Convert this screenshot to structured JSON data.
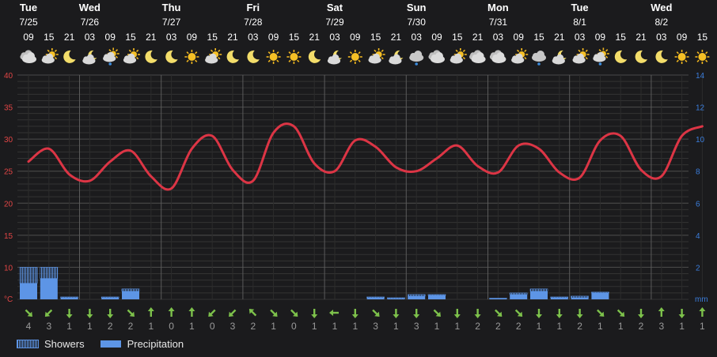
{
  "legend": {
    "showers": "Showers",
    "precipitation": "Precipitation"
  },
  "axis": {
    "temp_unit": "°C",
    "precip_unit": "mm",
    "temp_ticks": [
      10,
      15,
      20,
      25,
      30,
      35,
      40
    ],
    "precip_ticks": [
      2,
      4,
      6,
      8,
      10,
      12,
      14
    ]
  },
  "days": [
    {
      "dow": "Tue",
      "date": "7/25",
      "hour_index": 0
    },
    {
      "dow": "Wed",
      "date": "7/26",
      "hour_index": 3
    },
    {
      "dow": "Thu",
      "date": "7/27",
      "hour_index": 7
    },
    {
      "dow": "Fri",
      "date": "7/28",
      "hour_index": 11
    },
    {
      "dow": "Sat",
      "date": "7/29",
      "hour_index": 15
    },
    {
      "dow": "Sun",
      "date": "7/30",
      "hour_index": 19
    },
    {
      "dow": "Mon",
      "date": "7/31",
      "hour_index": 23
    },
    {
      "dow": "Tue",
      "date": "8/1",
      "hour_index": 27
    },
    {
      "dow": "Wed",
      "date": "8/2",
      "hour_index": 31
    }
  ],
  "hours": [
    "09",
    "15",
    "21",
    "03",
    "09",
    "15",
    "21",
    "03",
    "09",
    "15",
    "21",
    "03",
    "09",
    "15",
    "21",
    "03",
    "09",
    "15",
    "21",
    "03",
    "09",
    "15",
    "21",
    "03",
    "09",
    "15",
    "21",
    "03",
    "09",
    "15",
    "21",
    "03",
    "09",
    "15"
  ],
  "icons": [
    "cloudy",
    "partly-sunny",
    "moon",
    "moon-cloud",
    "rain-sun",
    "partly-sunny",
    "moon",
    "moon",
    "sun",
    "partly-sunny",
    "moon",
    "moon",
    "sun",
    "sun",
    "moon",
    "moon-cloud",
    "sun",
    "partly-sunny",
    "moon-cloud",
    "rain-cloud",
    "cloudy",
    "partly-sunny",
    "cloudy",
    "cloudy",
    "partly-sunny",
    "rain-cloud",
    "moon-cloud",
    "partly-sunny",
    "rain-sun",
    "moon",
    "moon",
    "moon",
    "sun",
    "sun"
  ],
  "wind": {
    "speeds": [
      4,
      3,
      1,
      1,
      2,
      2,
      1,
      0,
      1,
      0,
      3,
      2,
      1,
      0,
      1,
      1,
      1,
      3,
      1,
      3,
      1,
      1,
      2,
      2,
      2,
      1,
      1,
      2,
      1,
      1,
      2,
      3,
      1,
      1,
      1,
      2
    ],
    "dirs": [
      "se",
      "sw",
      "e",
      "s",
      "s",
      "se",
      "n",
      "n",
      "n",
      "sw",
      "sw",
      "nw",
      "se",
      "se",
      "s",
      "w",
      "e",
      "se",
      "s",
      "s",
      "se",
      "s",
      "s",
      "se",
      "se",
      "e",
      "s",
      "e",
      "se",
      "se",
      "s",
      "n",
      "s",
      "n",
      "e",
      "s"
    ],
    "color": "#7dc14b"
  },
  "chart_data": {
    "type": "line",
    "x": [
      "7/25 09",
      "7/25 15",
      "7/25 21",
      "7/26 03",
      "7/26 09",
      "7/26 15",
      "7/26 21",
      "7/27 03",
      "7/27 09",
      "7/27 15",
      "7/27 21",
      "7/28 03",
      "7/28 09",
      "7/28 15",
      "7/28 21",
      "7/29 03",
      "7/29 09",
      "7/29 15",
      "7/29 21",
      "7/30 03",
      "7/30 09",
      "7/30 15",
      "7/30 21",
      "7/31 03",
      "7/31 09",
      "7/31 15",
      "7/31 21",
      "8/1 03",
      "8/1 09",
      "8/1 15",
      "8/1 21",
      "8/2 03",
      "8/2 09",
      "8/2 15"
    ],
    "series": [
      {
        "name": "Temperature",
        "unit": "°C",
        "color": "#dc3545",
        "values": [
          26.5,
          28.5,
          24.5,
          23.5,
          26.5,
          28.2,
          24.2,
          22.3,
          28.5,
          30.5,
          25.2,
          23.5,
          31.0,
          32.0,
          26.2,
          25.0,
          29.8,
          28.8,
          25.6,
          25.0,
          27.0,
          29.0,
          25.8,
          24.8,
          29.0,
          28.5,
          24.8,
          24.0,
          29.8,
          30.5,
          25.2,
          24.2,
          30.5,
          32.0
        ]
      },
      {
        "name": "Precipitation",
        "unit": "mm",
        "color": "#5d95e6",
        "values": [
          1.0,
          1.3,
          0.1,
          0,
          0.1,
          0.5,
          0,
          0,
          0,
          0,
          0,
          0,
          0,
          0,
          0,
          0,
          0,
          0.1,
          0.05,
          0.2,
          0.25,
          0,
          0,
          0.05,
          0.3,
          0.5,
          0.1,
          0.1,
          0.4,
          0,
          0,
          0,
          0,
          0
        ]
      },
      {
        "name": "Showers",
        "unit": "mm",
        "color": "#5d95e6",
        "values": [
          1.0,
          0.7,
          0.05,
          0,
          0.05,
          0.15,
          0,
          0,
          0,
          0,
          0,
          0,
          0,
          0,
          0,
          0,
          0,
          0.05,
          0.05,
          0.1,
          0.05,
          0,
          0,
          0.02,
          0.1,
          0.15,
          0.05,
          0.1,
          0.05,
          0,
          0,
          0,
          0,
          0
        ]
      }
    ],
    "ylim_temp": [
      5,
      40
    ],
    "ylim_precip": [
      0,
      14
    ],
    "grid": true,
    "legend_position": "bottom-left"
  },
  "colors": {
    "background": "#1b1b1d",
    "grid": "#3a3a3a",
    "temp_axis": "#e04545",
    "precip_axis": "#3b7ddb"
  }
}
